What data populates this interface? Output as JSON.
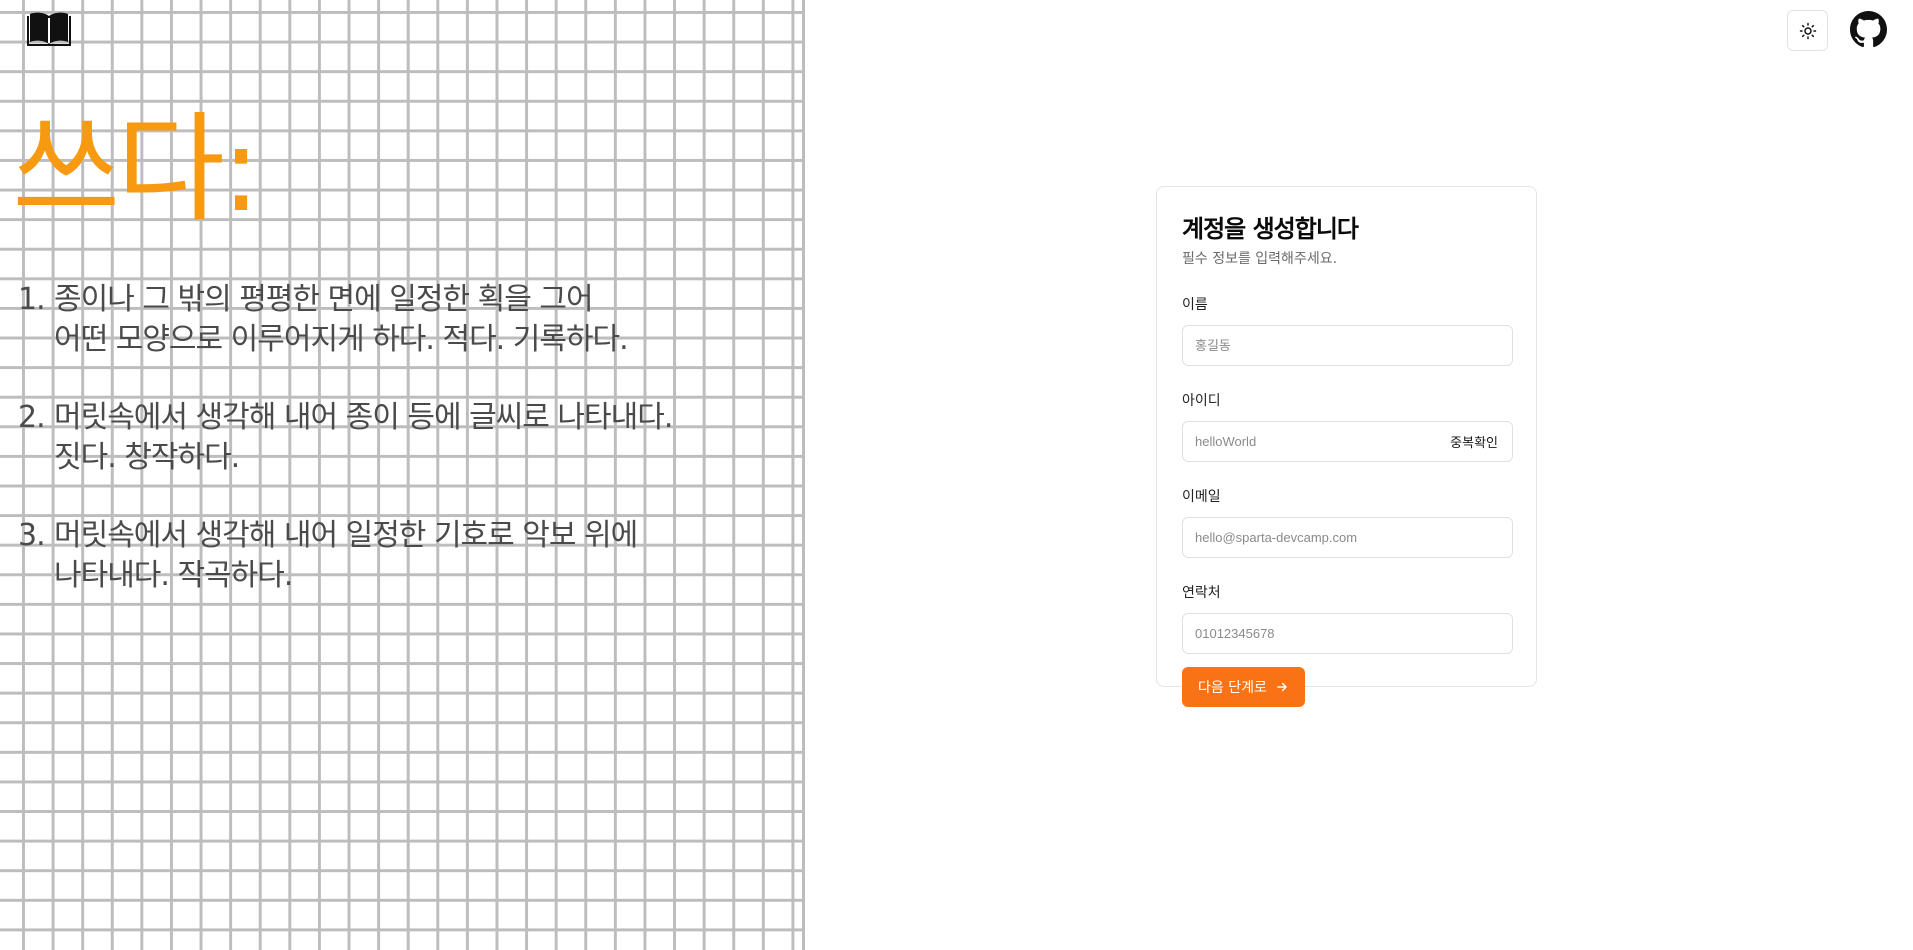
{
  "hero": {
    "title": "쓰다:",
    "definitions": [
      {
        "num": "1.",
        "text": "종이나 그 밖의 평평한 면에 일정한 획을 그어\n어떤 모양으로 이루어지게 하다. 적다. 기록하다."
      },
      {
        "num": "2.",
        "text": "머릿속에서 생각해 내어 종이 등에 글씨로 나타내다.\n짓다. 창작하다."
      },
      {
        "num": "3.",
        "text": "머릿속에서 생각해 내어 일정한 기호로 악보 위에\n나타내다. 작곡하다."
      }
    ]
  },
  "icons": {
    "logo": "book-open-icon",
    "theme": "sun-icon",
    "github": "github-icon"
  },
  "form": {
    "title": "계정을 생성합니다",
    "subtitle": "필수 정보를 입력해주세요.",
    "name_label": "이름",
    "name_placeholder": "홍길동",
    "id_label": "아이디",
    "id_placeholder": "helloWorld",
    "id_check_label": "중복확인",
    "email_label": "이메일",
    "email_placeholder": "hello@sparta-devcamp.com",
    "phone_label": "연락처",
    "phone_placeholder": "01012345678",
    "next_label": "다음 단계로"
  },
  "colors": {
    "accent": "#f97316",
    "hero": "#f79a12",
    "grid": "#bdbdbd"
  }
}
